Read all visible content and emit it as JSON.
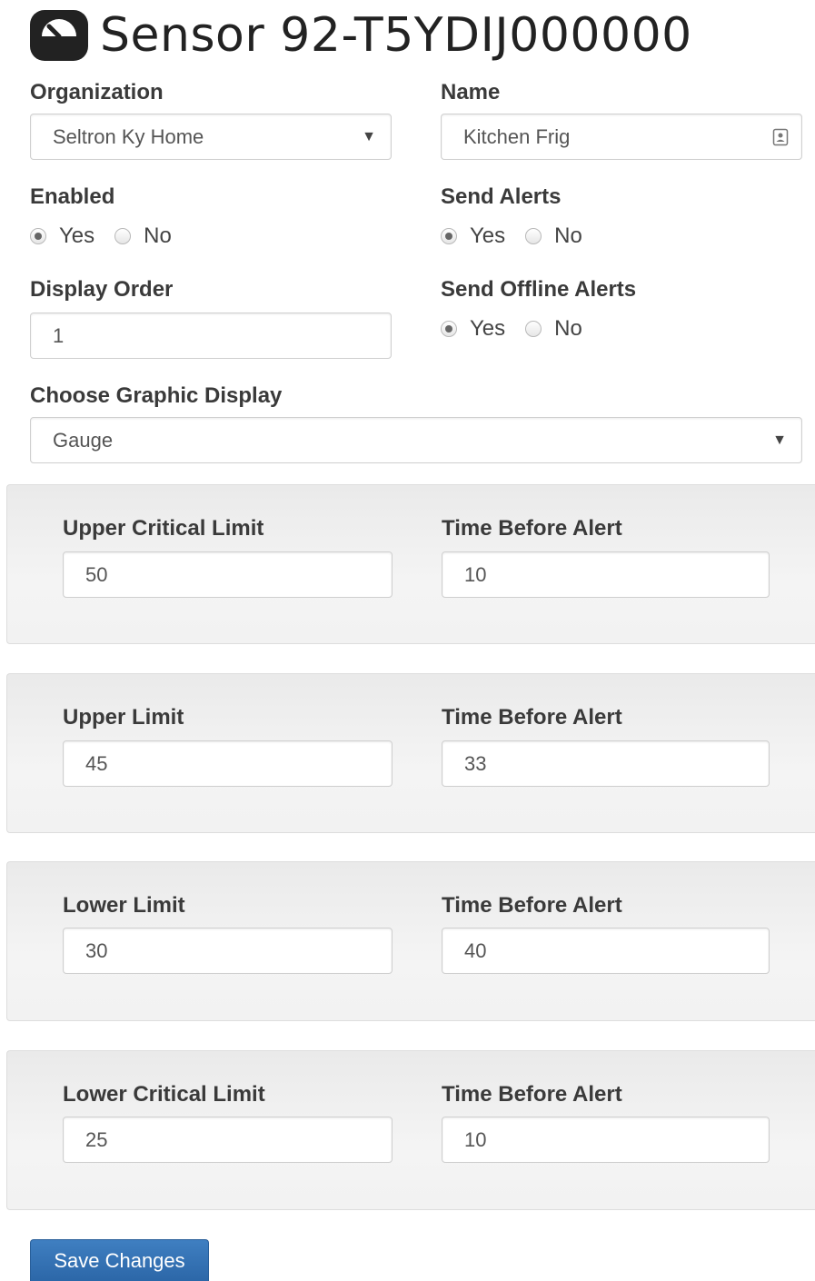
{
  "header": {
    "icon": "gauge-icon",
    "title": "Sensor 92-T5YDIJ000000"
  },
  "organization": {
    "label": "Organization",
    "value": "Seltron Ky Home"
  },
  "name": {
    "label": "Name",
    "value": "Kitchen Frig"
  },
  "enabled": {
    "label": "Enabled",
    "yes": "Yes",
    "no": "No",
    "selected": "Yes"
  },
  "send_alerts": {
    "label": "Send Alerts",
    "yes": "Yes",
    "no": "No",
    "selected": "Yes"
  },
  "display_order": {
    "label": "Display Order",
    "value": "1"
  },
  "send_offline_alerts": {
    "label": "Send Offline Alerts",
    "yes": "Yes",
    "no": "No",
    "selected": "Yes"
  },
  "graphic_display": {
    "label": "Choose Graphic Display",
    "value": "Gauge"
  },
  "limits": [
    {
      "label": "Upper Critical Limit",
      "value": "50",
      "time_label": "Time Before Alert",
      "time_value": "10"
    },
    {
      "label": "Upper Limit",
      "value": "45",
      "time_label": "Time Before Alert",
      "time_value": "33"
    },
    {
      "label": "Lower Limit",
      "value": "30",
      "time_label": "Time Before Alert",
      "time_value": "40"
    },
    {
      "label": "Lower Critical Limit",
      "value": "25",
      "time_label": "Time Before Alert",
      "time_value": "10"
    }
  ],
  "save_button": {
    "label": "Save Changes",
    "color": "#337ab7"
  }
}
